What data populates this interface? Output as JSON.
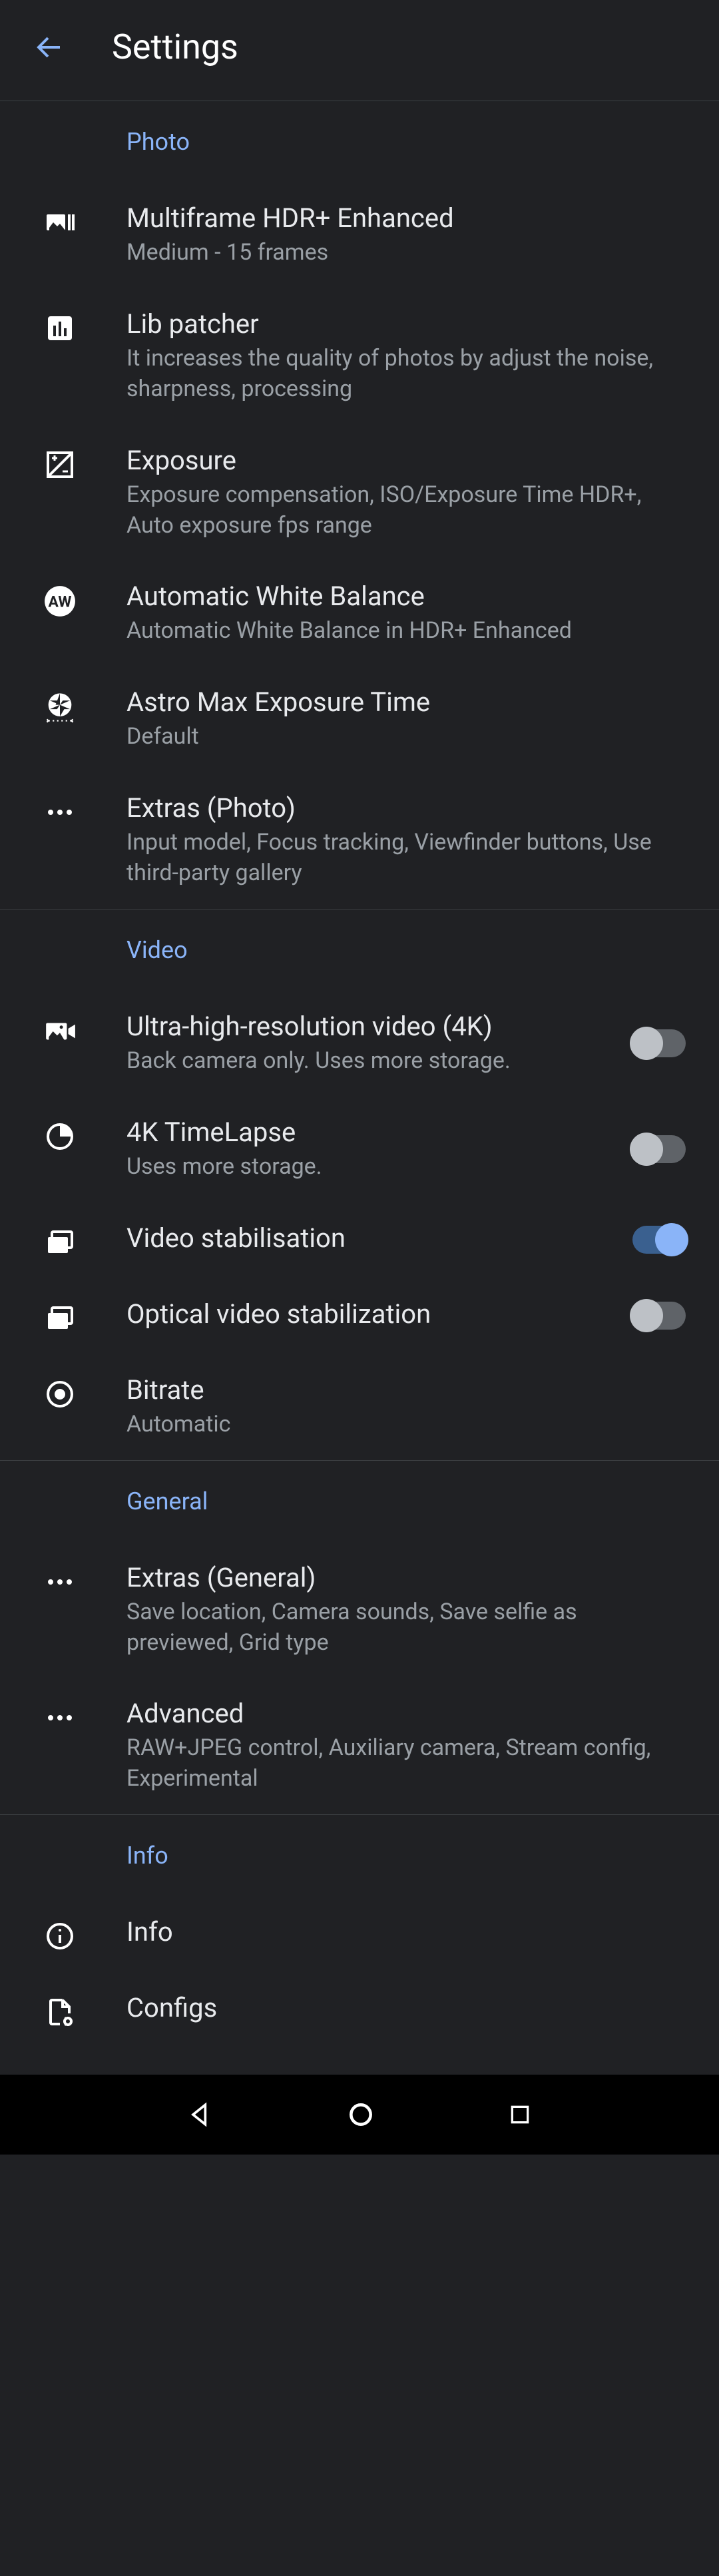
{
  "header": {
    "title": "Settings"
  },
  "sections": {
    "photo": {
      "label": "Photo",
      "multiframe": {
        "title": "Multiframe HDR+ Enhanced",
        "sub": "Medium - 15 frames"
      },
      "libpatcher": {
        "title": "Lib patcher",
        "sub": "It increases the quality of photos by adjust the noise, sharpness, processing"
      },
      "exposure": {
        "title": "Exposure",
        "sub": "Exposure compensation, ISO/Exposure Time HDR+, Auto exposure fps range"
      },
      "awb": {
        "title": "Automatic White Balance",
        "sub": "Automatic White Balance in HDR+ Enhanced"
      },
      "astro": {
        "title": "Astro Max Exposure Time",
        "sub": "Default"
      },
      "extras": {
        "title": "Extras (Photo)",
        "sub": "Input model, Focus tracking, Viewfinder buttons, Use third-party gallery"
      }
    },
    "video": {
      "label": "Video",
      "uhd": {
        "title": "Ultra-high-resolution video (4K)",
        "sub": "Back camera only. Uses more storage.",
        "on": false
      },
      "timelapse": {
        "title": "4K TimeLapse",
        "sub": "Uses more storage.",
        "on": false
      },
      "stab": {
        "title": "Video stabilisation",
        "on": true
      },
      "optical": {
        "title": "Optical video stabilization",
        "on": false
      },
      "bitrate": {
        "title": "Bitrate",
        "sub": "Automatic"
      }
    },
    "general": {
      "label": "General",
      "extras": {
        "title": "Extras (General)",
        "sub": "Save location, Camera sounds, Save selfie as previewed, Grid type"
      },
      "advanced": {
        "title": "Advanced",
        "sub": "RAW+JPEG control, Auxiliary camera, Stream config, Experimental"
      }
    },
    "info": {
      "label": "Info",
      "info": {
        "title": "Info"
      },
      "configs": {
        "title": "Configs"
      }
    }
  }
}
